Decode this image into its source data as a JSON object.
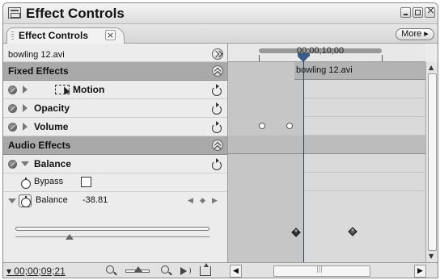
{
  "window": {
    "title": "Effect Controls"
  },
  "tab": {
    "label": "Effect Controls",
    "close_glyph": "×"
  },
  "more_button": "More ▸",
  "clip_source": "bowling 12.avi",
  "sections": {
    "fixed_effects": "Fixed Effects",
    "audio_effects": "Audio Effects"
  },
  "effects": {
    "motion": "Motion",
    "opacity": "Opacity",
    "volume": "Volume",
    "balance_group": "Balance",
    "bypass": "Bypass",
    "balance_param": "Balance",
    "balance_value": "-38.81",
    "balance_slider_level": 0.28
  },
  "timeline": {
    "time_label": "00;00;10;00",
    "clip_label": "bowling 12.avi"
  },
  "footer": {
    "timecode": "00;00;09;21"
  },
  "icons": [
    "app-icon",
    "minimize-icon",
    "maximize-icon",
    "close-icon",
    "tab-close-icon",
    "effect-toggle-icon",
    "expand-triangle-icon",
    "motion-icon",
    "reset-icon",
    "collapse-icon",
    "stopwatch-icon",
    "keyframe-nav-icon",
    "zoom-out-icon",
    "zoom-in-icon",
    "play-audio-icon",
    "loop-icon"
  ],
  "colors": {
    "section_header": "#a9a9a9",
    "timeline_bg": "#dadada",
    "cti": "#3a5a8a"
  }
}
